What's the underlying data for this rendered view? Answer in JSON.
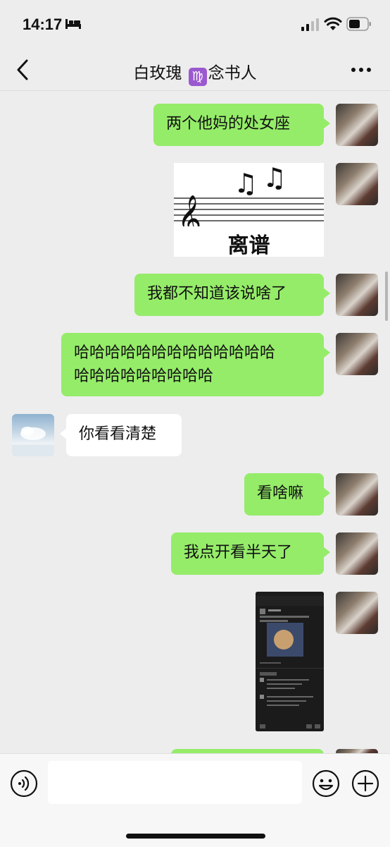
{
  "status": {
    "time": "14:17"
  },
  "header": {
    "title_left": "白玫瑰",
    "virgo_symbol": "♍",
    "title_right": "念书人"
  },
  "messages": [
    {
      "from": "me",
      "text": "两个他妈的处女座"
    },
    {
      "from": "me",
      "type": "sticker",
      "caption": "离谱"
    },
    {
      "from": "me",
      "text": "我都不知道该说啥了"
    },
    {
      "from": "me",
      "lines": [
        "哈哈哈哈哈哈哈哈哈哈哈哈哈",
        "哈哈哈哈哈哈哈哈哈"
      ]
    },
    {
      "from": "other",
      "text": "你看看清楚"
    },
    {
      "from": "me",
      "text": "看啥嘛"
    },
    {
      "from": "me",
      "text": "我点开看半天了"
    },
    {
      "from": "me",
      "type": "screenshot"
    }
  ],
  "colors": {
    "my_bubble": "#95ec69",
    "their_bubble": "#ffffff",
    "background": "#ededed"
  },
  "icons": [
    "bed-icon",
    "signal-icon",
    "wifi-icon",
    "battery-icon",
    "back-icon",
    "more-icon",
    "voice-icon",
    "emoji-icon",
    "plus-icon"
  ]
}
